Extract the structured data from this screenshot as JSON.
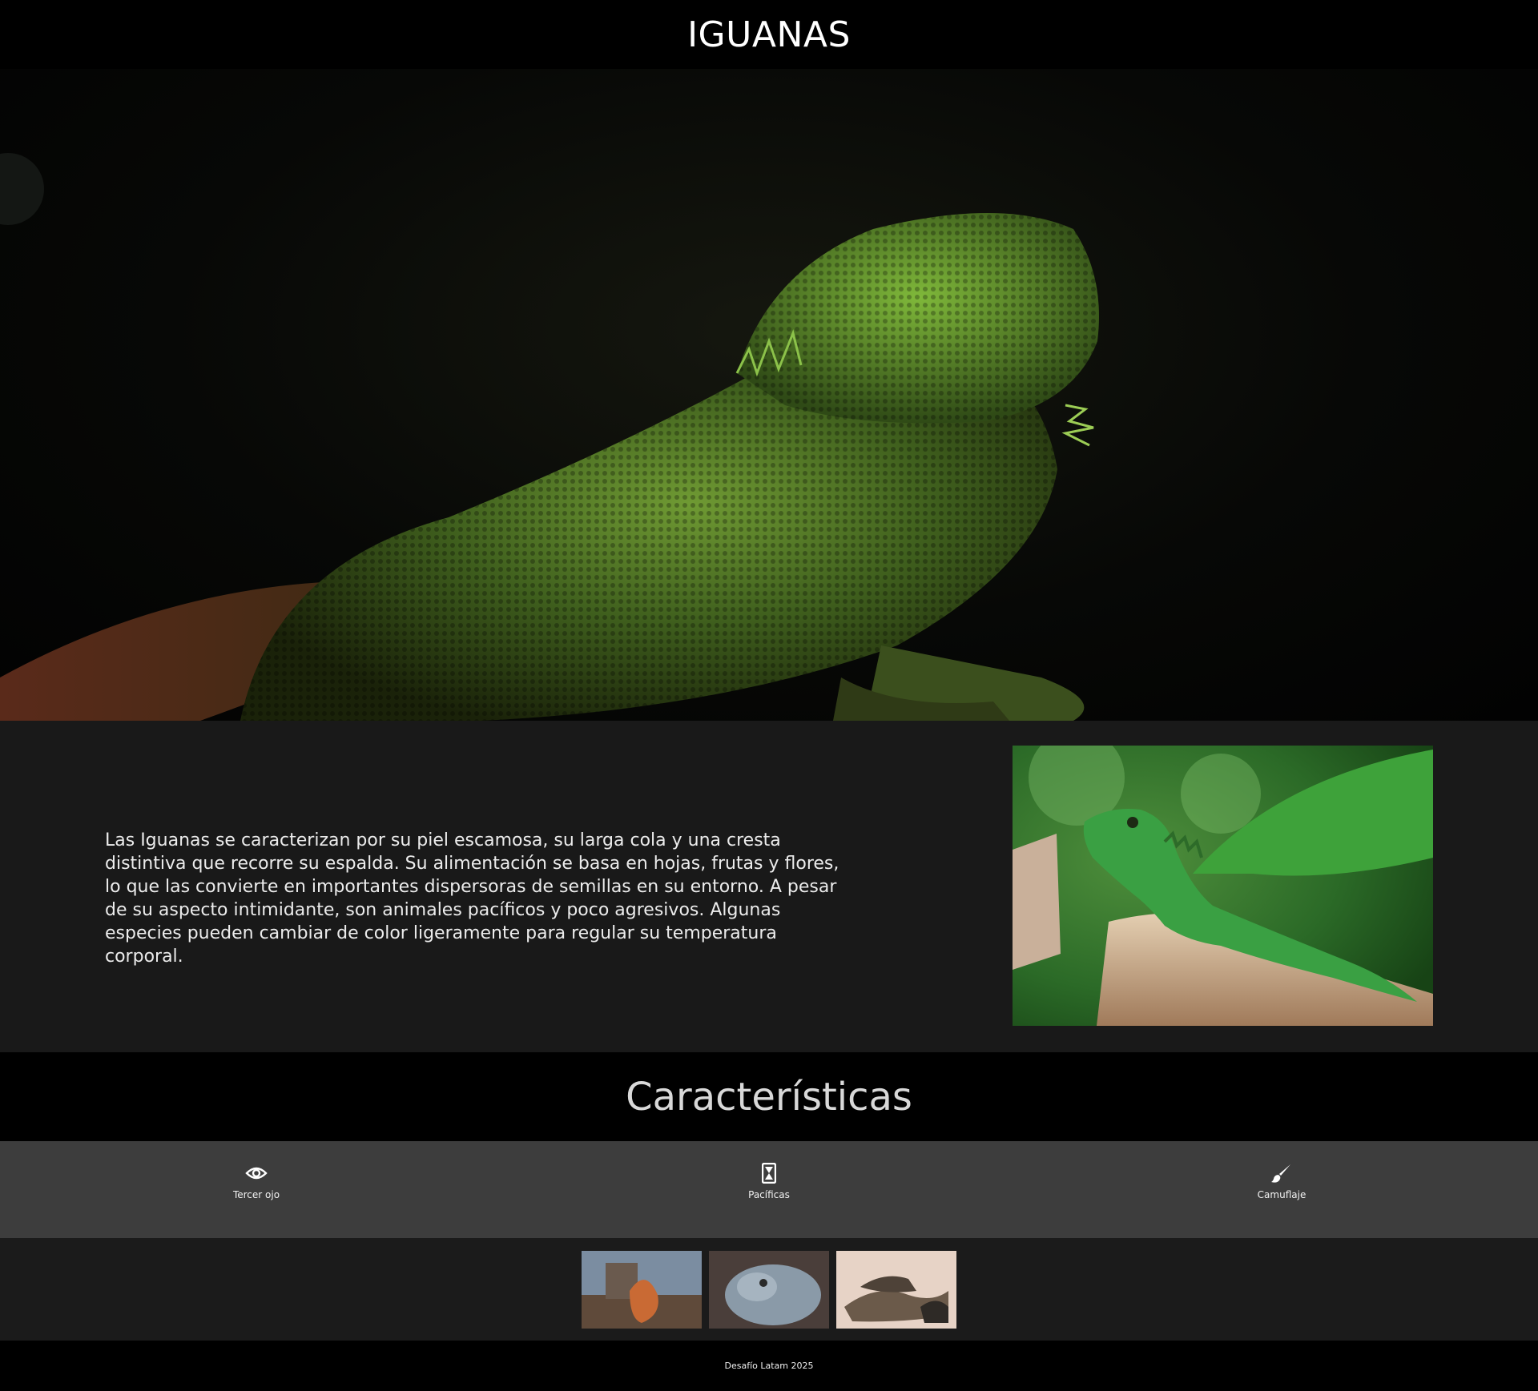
{
  "header": {
    "title": "IGUANAS"
  },
  "intro": {
    "text": "Las Iguanas se caracterizan por su piel escamosa, su larga cola y una cresta distintiva que recorre su espalda. Su alimentación se basa en hojas, frutas y flores, lo que las convierte en importantes dispersoras de semillas en su entorno. A pesar de su aspecto intimidante, son animales pacíficos y poco agresivos. Algunas especies pueden cambiar de color ligeramente para regular su temperatura corporal."
  },
  "features": {
    "heading": "Características",
    "items": [
      {
        "label": "Tercer ojo",
        "icon": "eye-icon"
      },
      {
        "label": "Pacíficas",
        "icon": "hourglass-icon"
      },
      {
        "label": "Camuflaje",
        "icon": "paintbrush-icon"
      }
    ]
  },
  "gallery": {
    "images": [
      "iguana-on-rock-photo",
      "iguana-head-photo",
      "iguanas-group-photo"
    ]
  },
  "footer": {
    "text": "Desafío Latam 2025"
  },
  "colors": {
    "header_bg": "#000000",
    "intro_bg": "#191919",
    "features_bg": "#3d3d3d",
    "gallery_bg": "#1b1b1b"
  }
}
